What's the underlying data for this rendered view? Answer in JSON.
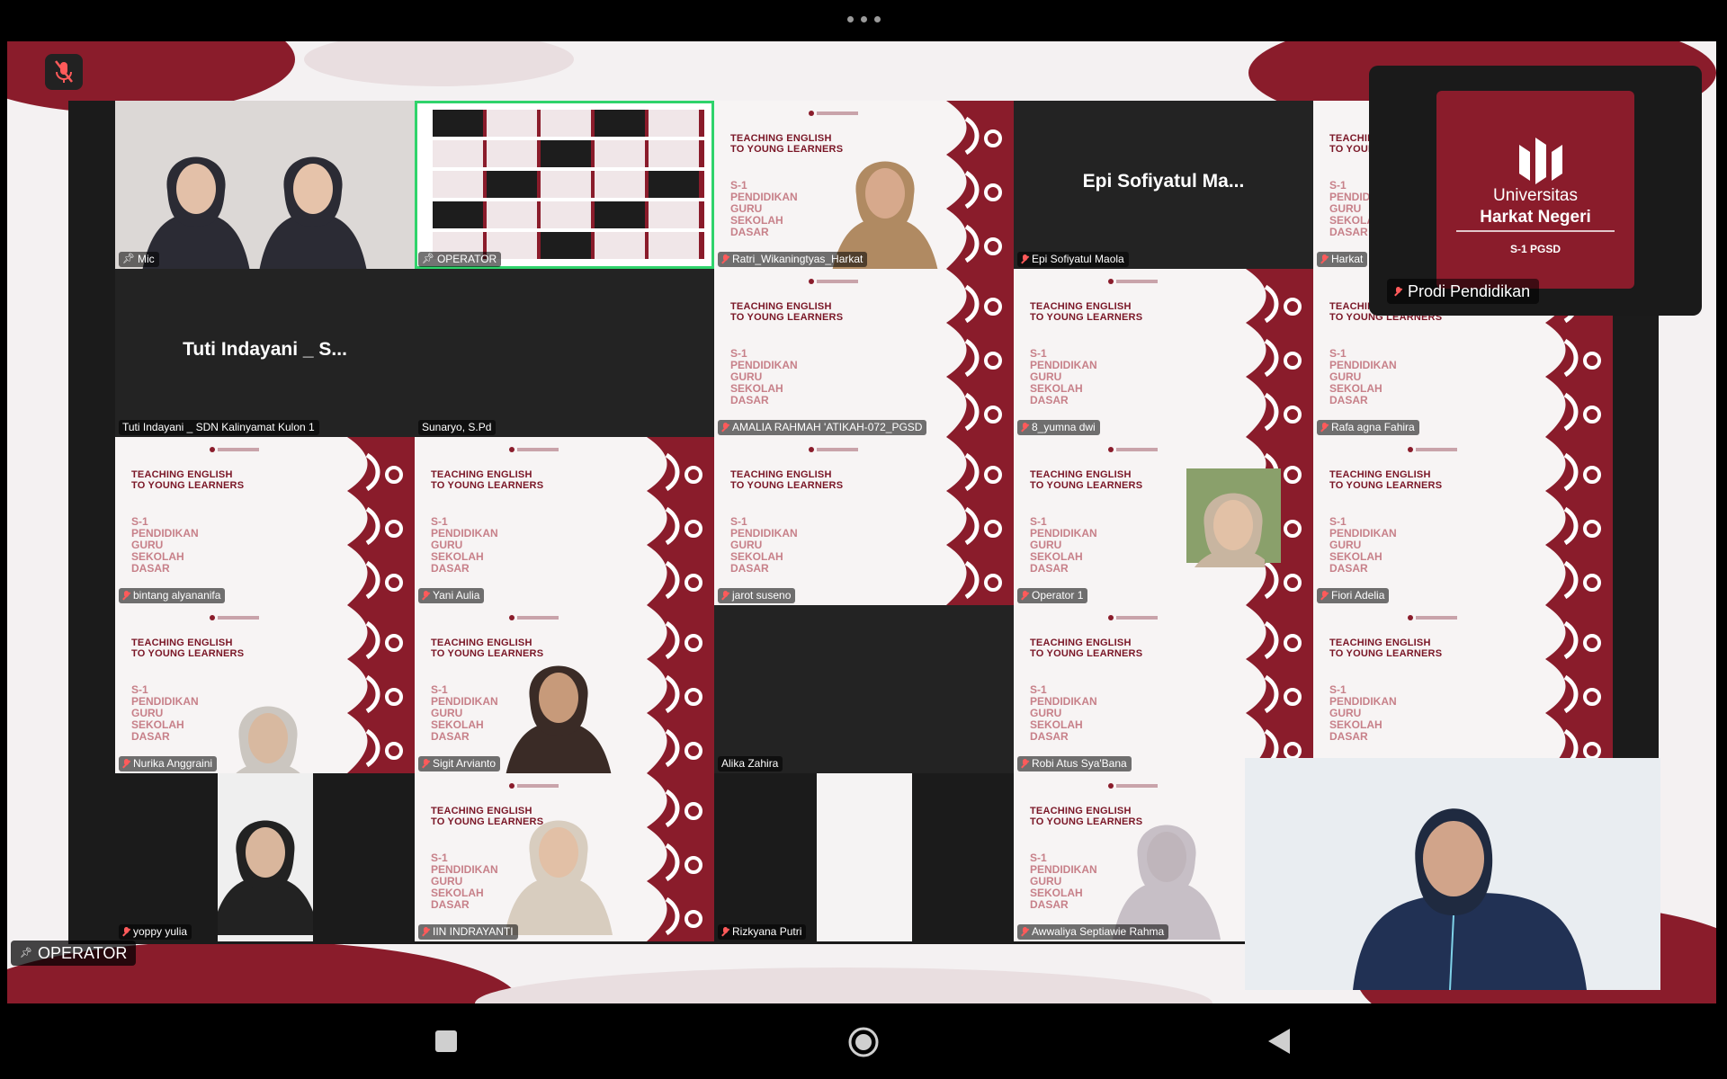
{
  "window": {
    "more_menu_icon": "more-horizontal-icon"
  },
  "colors": {
    "brand": "#8a1c2b",
    "active_speaker_outline": "#2fd36b",
    "muted_mic": "#ff5a5a"
  },
  "controls": {
    "mute_icon": "mic-off-icon"
  },
  "participants": [
    {
      "label": "Mic",
      "kind": "video",
      "pinned": true
    },
    {
      "label": "OPERATOR",
      "kind": "screen",
      "pinned": true,
      "active": true
    },
    {
      "label": "Ratri_Wikaningtyas_Harkat",
      "kind": "slide-video",
      "muted": true
    },
    {
      "label": "Epi Sofiyatul Maola",
      "kind": "avatar",
      "big_name": "Epi Sofiyatul Ma...",
      "muted": true
    },
    {
      "label": "Harkat",
      "kind": "slide",
      "muted": true
    },
    {
      "label": "Tuti Indayani _ SDN Kalinyamat Kulon 1",
      "kind": "avatar",
      "big_name": "Tuti Indayani _ S..."
    },
    {
      "label": "Sunaryo, S.Pd",
      "kind": "blank"
    },
    {
      "label": "AMALIA RAHMAH 'ATIKAH-072_PGSD",
      "kind": "slide",
      "muted": true
    },
    {
      "label": "8_yumna dwi",
      "kind": "slide",
      "muted": true
    },
    {
      "label": "Rafa agna Fahira",
      "kind": "slide",
      "muted": true
    },
    {
      "label": "bintang alyananifa",
      "kind": "slide",
      "muted": true
    },
    {
      "label": "Yani Aulia",
      "kind": "slide",
      "muted": true
    },
    {
      "label": "jarot suseno",
      "kind": "slide",
      "muted": true
    },
    {
      "label": "Operator 1",
      "kind": "slide-photo",
      "muted": true
    },
    {
      "label": "Fiori Adelia",
      "kind": "slide",
      "muted": true
    },
    {
      "label": "Nurika Anggraini",
      "kind": "slide-video",
      "muted": true
    },
    {
      "label": "Sigit Arvianto",
      "kind": "slide-video",
      "muted": true
    },
    {
      "label": "Alika Zahira",
      "kind": "blank"
    },
    {
      "label": "Robi Atus Sya'Bana",
      "kind": "slide",
      "muted": true
    },
    {
      "label": "",
      "kind": "slide"
    },
    {
      "label": "yoppy yulia",
      "kind": "video",
      "muted": true
    },
    {
      "label": "IIN INDRAYANTI",
      "kind": "slide-video",
      "muted": true
    },
    {
      "label": "Rizkyana Putri",
      "kind": "video",
      "muted": true
    },
    {
      "label": "Awwaliya Septiawie Rahma",
      "kind": "slide-video",
      "muted": true
    }
  ],
  "slide": {
    "title_lines": [
      "TEACHING ENGLISH",
      "TO YOUNG LEARNERS"
    ],
    "program_lines": [
      "S-1",
      "PENDIDIKAN",
      "GURU",
      "SEKOLAH",
      "DASAR"
    ]
  },
  "pip": {
    "label": "Prodi Pendidikan",
    "logo_line1": "Universitas",
    "logo_line2": "Harkat Negeri",
    "logo_line3": "S-1 PGSD"
  },
  "self_view": {
    "label": "OPERATOR"
  },
  "navbar": {
    "recent_icon": "recent-apps-icon",
    "home_icon": "home-icon",
    "back_icon": "back-icon"
  }
}
